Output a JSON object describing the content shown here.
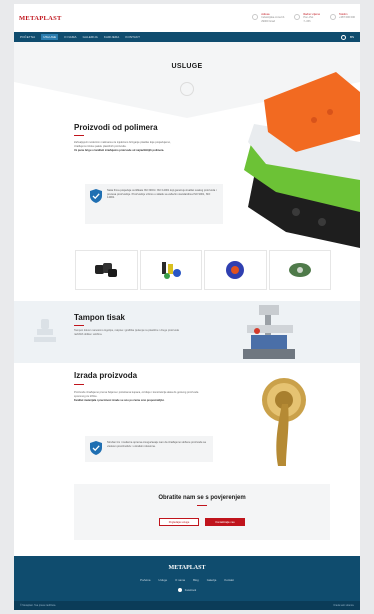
{
  "header": {
    "logo": "METAPLAST",
    "contacts": [
      {
        "label": "Adresa",
        "line1": "Industrijska zona bb",
        "line2": "29000 Grad",
        "icon": "location-icon"
      },
      {
        "label": "Radno vrijeme",
        "line1": "Pon–Pet",
        "line2": "7–15h",
        "icon": "clock-icon"
      },
      {
        "label": "Telefon",
        "line1": "+387 000 000",
        "line2": "",
        "icon": "phone-icon"
      }
    ]
  },
  "nav": {
    "items": [
      "Početna",
      "Usluge",
      "O nama",
      "Galerija",
      "Karijera",
      "Kontakt"
    ],
    "active_index": 1,
    "lang": "BS"
  },
  "hero": {
    "title": "USLUGE"
  },
  "section_polymer": {
    "title": "Proizvodi od polimera",
    "intro": "Zahvaljujući modernim mašinama za injekciono brizganje plastike koje posjedujemo, izrađujemo široku paletu plastičnih proizvoda.",
    "emphasis": "Uz punu brigu o kvaliteti izrađujemo proizvode od najrazličitijih polimera.",
    "info_text": "Naša firma posjeduje certifikate ISO 9001 i ISO 14001 koji garantuju kvalitet svakog proizvoda i procesa proizvodnje. Proizvodnju vršimo u skladu sa važećim standardima ISO 9001, ISO 14001."
  },
  "section_tampon": {
    "title": "Tampon tisak",
    "text": "Tampon tiskom nanosimo logotipe, natpise i grafička rješenja na plastične i druge proizvode različitih oblika i veličina."
  },
  "section_izrada": {
    "title": "Izrada proizvoda",
    "text": "Proizvode izrađujemo prema željama i potrebama kupaca, od ideje i konstrukcije alata do gotovog proizvoda spremnog za tržište.",
    "emphasis": "Kvalitet materijala i preciznost izrade su ono po čemu smo prepoznatljivi.",
    "info_text": "Stručan tim i moderna oprema omogućavaju nam da izrađujemo složene proizvode sa visokom preciznošću i u kratkim rokovima."
  },
  "cta": {
    "title": "Obratite nam se s povjerenjem",
    "secondary_label": "Pogledajte usluge",
    "primary_label": "Kontaktirajte nas"
  },
  "footer": {
    "logo": "METAPLAST",
    "links": [
      "Početna",
      "Usluge",
      "O nama",
      "Blog",
      "Galerija",
      "Kontakt"
    ],
    "social_label": "Facebook",
    "copyright": "© Metaplast. Sva prava zadržana.",
    "credit": "Izrada web stranice"
  },
  "colors": {
    "brand_red": "#c0141c",
    "nav_blue": "#0f4c6e",
    "info_bg": "#f3f4f5",
    "shield_blue": "#1f6fb2"
  }
}
